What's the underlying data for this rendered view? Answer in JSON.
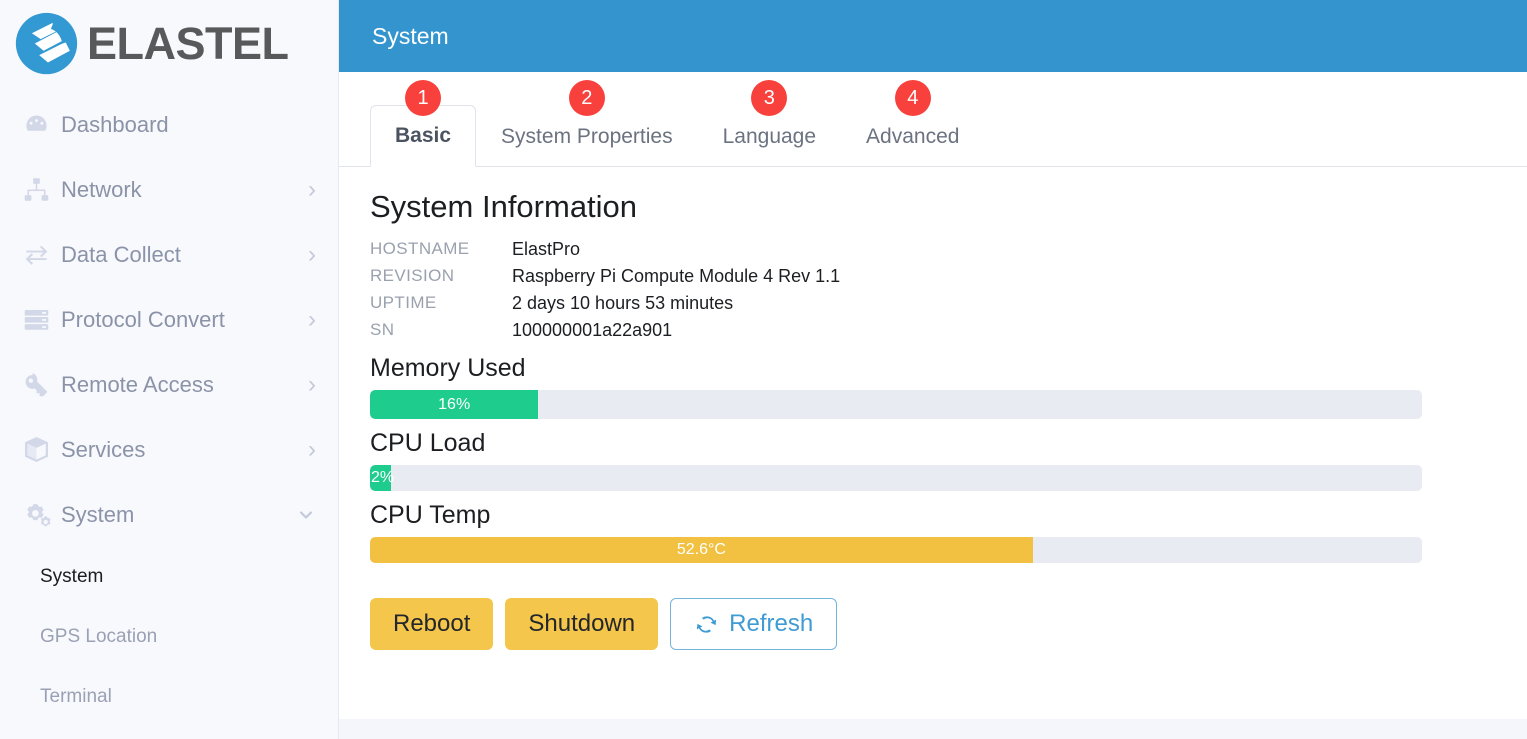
{
  "brand": {
    "name": "ELASTEL",
    "logo_icon": "elastel-logo-icon"
  },
  "sidebar": {
    "items": [
      {
        "label": "Dashboard",
        "icon": "tachometer-icon",
        "caret": ""
      },
      {
        "label": "Network",
        "icon": "sitemap-icon",
        "caret": "›"
      },
      {
        "label": "Data Collect",
        "icon": "exchange-arrows-icon",
        "caret": "›"
      },
      {
        "label": "Protocol Convert",
        "icon": "server-icon",
        "caret": "›"
      },
      {
        "label": "Remote Access",
        "icon": "key-icon",
        "caret": "›"
      },
      {
        "label": "Services",
        "icon": "cube-icon",
        "caret": "›"
      },
      {
        "label": "System",
        "icon": "cogs-icon",
        "caret": "⌄"
      }
    ],
    "sub_items": [
      {
        "label": "System",
        "active": true
      },
      {
        "label": "GPS Location",
        "active": false
      },
      {
        "label": "Terminal",
        "active": false
      }
    ]
  },
  "header": {
    "title": "System",
    "bg_color": "#3394ce"
  },
  "tabs": [
    {
      "label": "Basic",
      "badge": "1",
      "active": true
    },
    {
      "label": "System Properties",
      "badge": "2",
      "active": false
    },
    {
      "label": "Language",
      "badge": "3",
      "active": false
    },
    {
      "label": "Advanced",
      "badge": "4",
      "active": false
    }
  ],
  "tab_badge_color": "#f8403c",
  "system_information": {
    "title": "System Information",
    "rows": [
      {
        "key": "HOSTNAME",
        "value": "ElastPro"
      },
      {
        "key": "REVISION",
        "value": "Raspberry Pi Compute Module 4 Rev 1.1"
      },
      {
        "key": "UPTIME",
        "value": "2 days 10 hours 53 minutes"
      },
      {
        "key": "SN",
        "value": "100000001a22a901"
      }
    ]
  },
  "metrics": [
    {
      "label": "Memory Used",
      "value_text": "16%",
      "percent": 16,
      "color": "#1ecd8e",
      "size": "tall"
    },
    {
      "label": "CPU Load",
      "value_text": "2%",
      "percent": 2,
      "color": "#1ecd8e",
      "size": "short"
    },
    {
      "label": "CPU Temp",
      "value_text": "52.6°C",
      "percent": 63,
      "color": "#f2c141",
      "size": "short"
    }
  ],
  "buttons": [
    {
      "label": "Reboot",
      "style": "warn",
      "icon": null
    },
    {
      "label": "Shutdown",
      "style": "warn",
      "icon": null
    },
    {
      "label": "Refresh",
      "style": "outline",
      "icon": "sync-refresh-icon"
    }
  ]
}
